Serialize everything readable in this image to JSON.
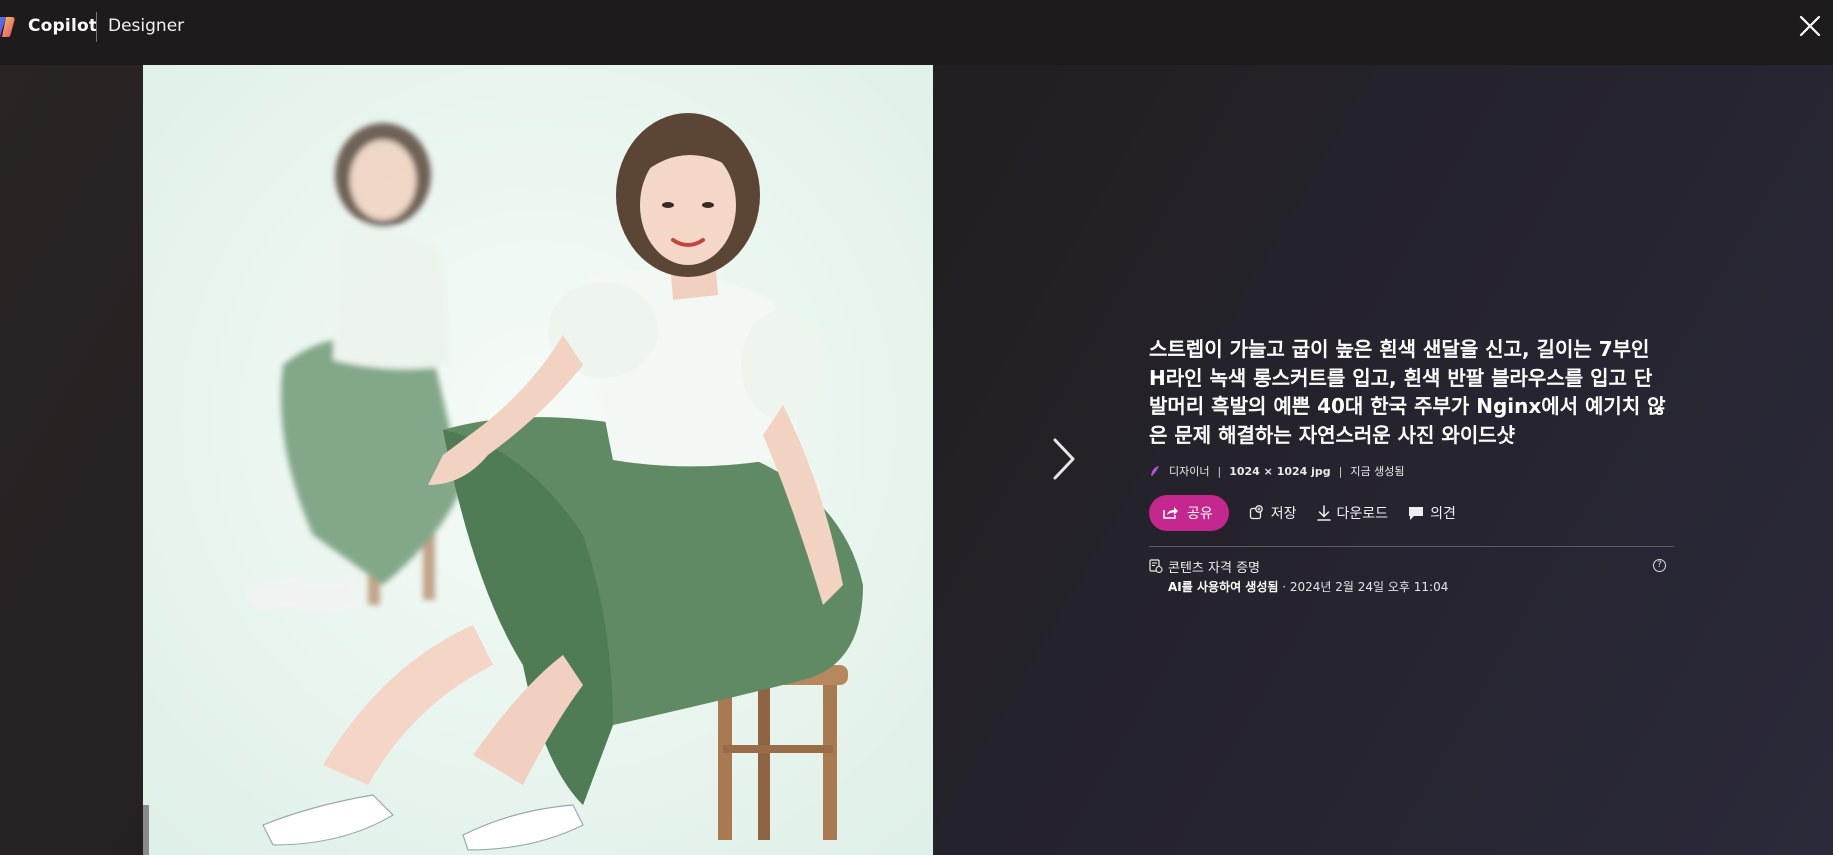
{
  "header": {
    "brand": "Copilot",
    "product": "Designer"
  },
  "image": {
    "alt": "스트렙이 가늘고 굽이 높은 흰색 샌달을 신고, 길이는 7부인 H라인 녹색 롱스커트를 입고, 흰색 반팔 블라우스를 입고 단발머리 흑발의 예쁜 40대 한국 주부가 Nginx에서 예기치 않은 문제 해결하는 자연스러운 사진 와이드샷"
  },
  "details": {
    "title": "스트렙이 가늘고 굽이 높은 흰색 샌달을 신고, 길이는 7부인 H라인 녹색 롱스커트를 입고, 흰색 반팔 블라우스를 입고 단발머리 흑발의 예쁜 40대 한국 주부가 Nginx에서 예기치 않은 문제 해결하는 자연스러운 사진 와이드샷",
    "meta": {
      "app": "디자이너",
      "resolution": "1024 × 1024 jpg",
      "time": "지금 생성됨"
    },
    "actions": {
      "share": "공유",
      "save": "저장",
      "download": "다운로드",
      "feedback": "의견"
    },
    "credentials": {
      "title": "콘텐츠 자격 증명",
      "ai_label": "AI를 사용하여 생성됨",
      "date": " · 2024년 2월 24일 오후 11:04"
    }
  },
  "colors": {
    "accent": "#c4278e",
    "topbar": "#1d1b1c"
  },
  "icons": [
    "copilot-logo-icon",
    "close-icon",
    "chevron-right-icon",
    "designer-app-icon",
    "share-icon",
    "save-icon",
    "download-icon",
    "comment-icon",
    "credentials-icon",
    "help-icon"
  ]
}
